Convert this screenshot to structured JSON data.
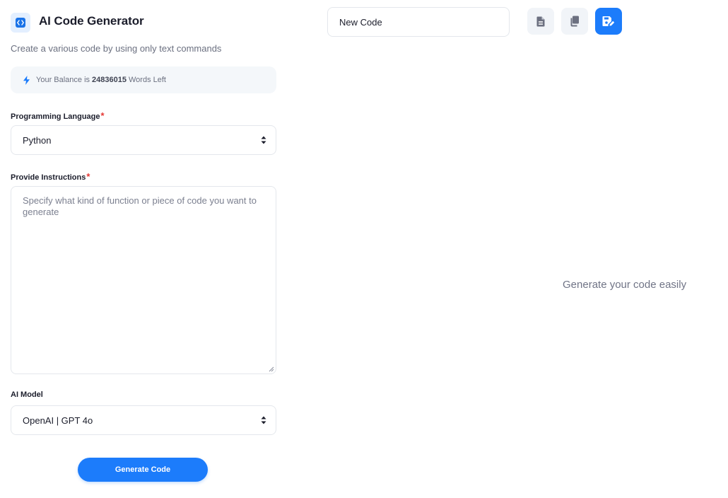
{
  "header": {
    "title": "AI Code Generator",
    "subtitle": "Create a various code by using only text commands",
    "icon": "code-icon"
  },
  "balance": {
    "prefix": "Your Balance is",
    "amount": "24836015",
    "suffix": "Words Left",
    "icon": "bolt-icon"
  },
  "form": {
    "language": {
      "label": "Programming Language",
      "required": "*",
      "value": "Python"
    },
    "instructions": {
      "label": "Provide Instructions",
      "required": "*",
      "placeholder": "Specify what kind of function or piece of code you want to generate"
    },
    "model": {
      "label": "AI Model",
      "value": "OpenAI | GPT 4o"
    },
    "submit_label": "Generate Code"
  },
  "output": {
    "document_name": "New Code",
    "empty_message": "Generate your code easily",
    "tools": [
      "document-icon",
      "copy-icon",
      "save-icon"
    ]
  },
  "colors": {
    "accent": "#1c7cfb",
    "required": "#e53935",
    "muted_bg": "#f4f7fa"
  }
}
